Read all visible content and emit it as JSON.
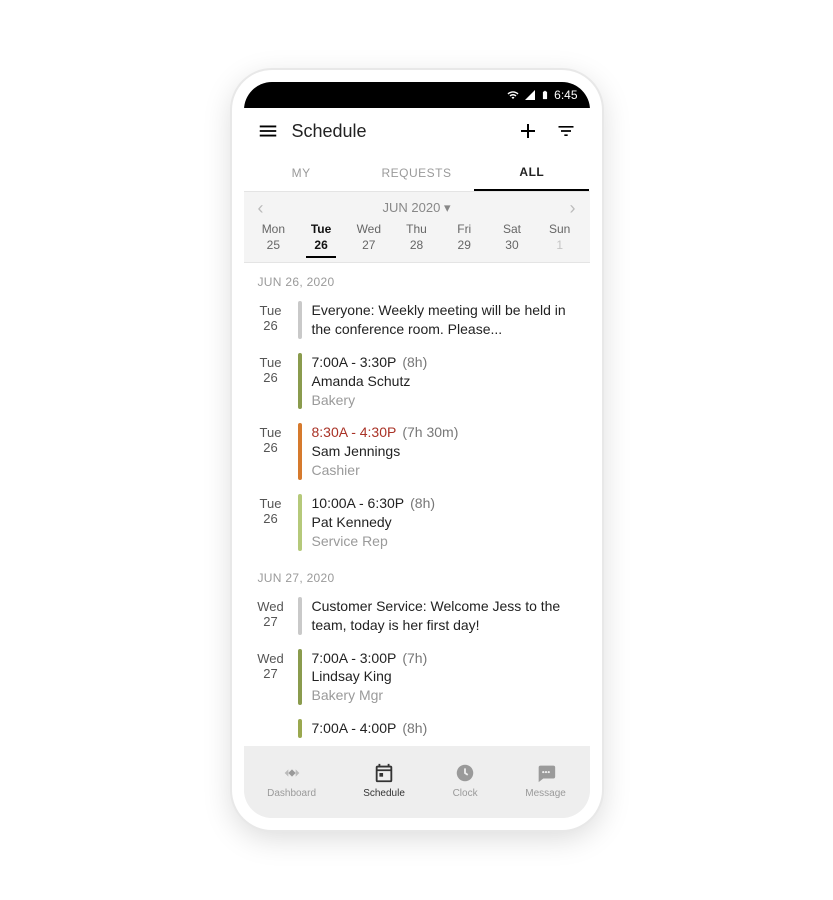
{
  "status": {
    "time": "6:45"
  },
  "header": {
    "title": "Schedule"
  },
  "tabs": [
    "MY",
    "REQUESTS",
    "ALL"
  ],
  "tabs_active": 2,
  "month": {
    "label": "JUN 2020"
  },
  "week": [
    {
      "dow": "Mon",
      "num": "25"
    },
    {
      "dow": "Tue",
      "num": "26",
      "selected": true
    },
    {
      "dow": "Wed",
      "num": "27"
    },
    {
      "dow": "Thu",
      "num": "28"
    },
    {
      "dow": "Fri",
      "num": "29"
    },
    {
      "dow": "Sat",
      "num": "30"
    },
    {
      "dow": "Sun",
      "num": "1",
      "dim": true
    }
  ],
  "sections": [
    {
      "header": "JUN 26, 2020",
      "rows": [
        {
          "type": "note",
          "day_dow": "Tue",
          "day_num": "26",
          "note": "Everyone: Weekly meeting will be held in the conference room. Please..."
        },
        {
          "type": "shift",
          "day_dow": "Tue",
          "day_num": "26",
          "stripe": "#8a9b4d",
          "time": "7:00A - 3:30P",
          "dur": "(8h)",
          "name": "Amanda Schutz",
          "role": "Bakery"
        },
        {
          "type": "shift",
          "day_dow": "Tue",
          "day_num": "26",
          "stripe": "#d67a2d",
          "time": "8:30A - 4:30P",
          "time_red": true,
          "dur": "(7h 30m)",
          "name": "Sam Jennings",
          "role": "Cashier"
        },
        {
          "type": "shift",
          "day_dow": "Tue",
          "day_num": "26",
          "stripe": "#b5c97a",
          "time": "10:00A - 6:30P",
          "dur": "(8h)",
          "name": "Pat Kennedy",
          "role": "Service Rep"
        }
      ]
    },
    {
      "header": "JUN 27, 2020",
      "rows": [
        {
          "type": "note",
          "day_dow": "Wed",
          "day_num": "27",
          "note": "Customer Service: Welcome Jess to the team, today is her first day!"
        },
        {
          "type": "shift",
          "day_dow": "Wed",
          "day_num": "27",
          "stripe": "#8a9b4d",
          "time": "7:00A - 3:00P",
          "dur": "(7h)",
          "name": "Lindsay King",
          "role": "Bakery Mgr"
        },
        {
          "type": "shift-partial",
          "day_dow": "",
          "day_num": "",
          "stripe": "#9aa84f",
          "time": "7:00A - 4:00P",
          "dur": "(8h)"
        }
      ]
    }
  ],
  "nav": [
    {
      "label": "Dashboard"
    },
    {
      "label": "Schedule",
      "active": true
    },
    {
      "label": "Clock"
    },
    {
      "label": "Message"
    }
  ]
}
